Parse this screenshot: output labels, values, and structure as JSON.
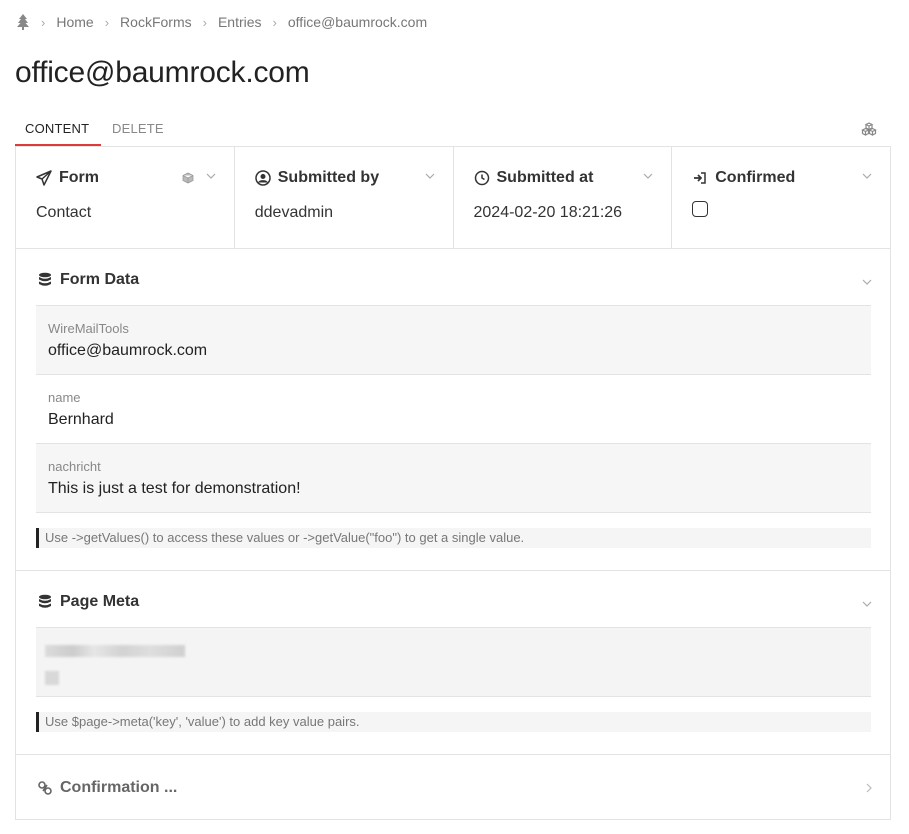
{
  "breadcrumb": {
    "items": [
      "Home",
      "RockForms",
      "Entries",
      "office@baumrock.com"
    ]
  },
  "page": {
    "title": "office@baumrock.com"
  },
  "tabs": {
    "content": "CONTENT",
    "delete": "DELETE"
  },
  "fields": {
    "form": {
      "label": "Form",
      "value": "Contact"
    },
    "submitted_by": {
      "label": "Submitted by",
      "value": "ddevadmin"
    },
    "submitted_at": {
      "label": "Submitted at",
      "value": "2024-02-20 18:21:26"
    },
    "confirmed": {
      "label": "Confirmed",
      "checked": false
    }
  },
  "form_data": {
    "title": "Form Data",
    "rows": [
      {
        "label": "WireMailTools",
        "value": "office@baumrock.com"
      },
      {
        "label": "name",
        "value": "Bernhard"
      },
      {
        "label": "nachricht",
        "value": "This is just a test for demonstration!"
      }
    ],
    "note": "Use ->getValues() to access these values or ->getValue(\"foo\") to get a single value."
  },
  "page_meta": {
    "title": "Page Meta",
    "note": "Use $page->meta('key', 'value') to add key value pairs."
  },
  "confirmation": {
    "title": "Confirmation ..."
  },
  "colors": {
    "accent": "#e03b3b",
    "border": "#e3e3e3",
    "text": "#333333"
  }
}
